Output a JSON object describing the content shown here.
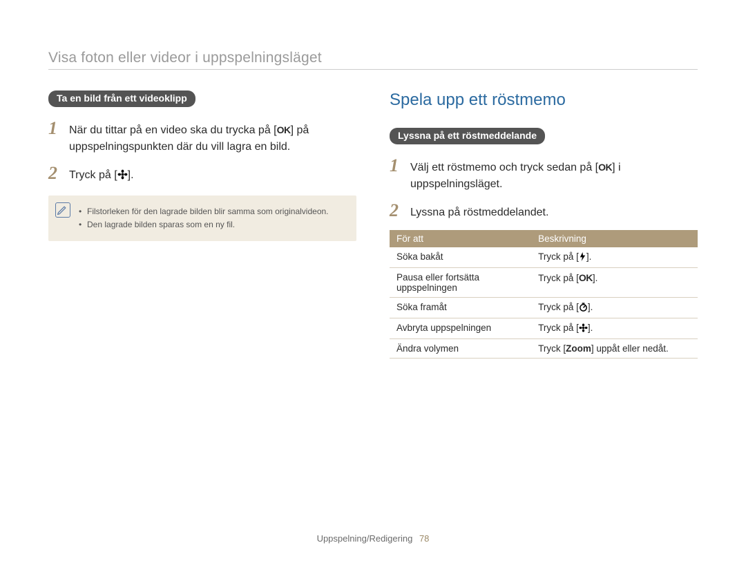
{
  "page_title": "Visa foton eller videor i uppspelningsläget",
  "left": {
    "pill": "Ta en bild från ett videoklipp",
    "step1_a": "När du tittar på en video ska du trycka på [",
    "step1_b": "] på uppspelningspunkten där du vill lagra en bild.",
    "step2_a": "Tryck på [",
    "step2_b": "].",
    "note_items": [
      "Filstorleken för den lagrade bilden blir samma som originalvideon.",
      "Den lagrade bilden sparas som en ny fil."
    ]
  },
  "right": {
    "heading": "Spela upp ett röstmemo",
    "pill": "Lyssna på ett röstmeddelande",
    "step1_a": "Välj ett röstmemo och tryck sedan på [",
    "step1_b": "] i uppspelningsläget.",
    "step2": "Lyssna på röstmeddelandet.",
    "table": {
      "headers": [
        "För att",
        "Beskrivning"
      ],
      "rows": [
        {
          "action": "Söka bakåt",
          "desc_a": "Tryck på [",
          "icon": "flash",
          "desc_b": "]."
        },
        {
          "action": "Pausa eller fortsätta uppspelningen",
          "desc_a": "Tryck på [",
          "icon": "ok",
          "desc_b": "]."
        },
        {
          "action": "Söka framåt",
          "desc_a": "Tryck på [",
          "icon": "timer",
          "desc_b": "]."
        },
        {
          "action": "Avbryta uppspelningen",
          "desc_a": "Tryck på [",
          "icon": "flower",
          "desc_b": "]."
        },
        {
          "action": "Ändra volymen",
          "desc_a": "Tryck [",
          "strong": "Zoom",
          "desc_b": "] uppåt eller nedåt."
        }
      ]
    }
  },
  "footer": {
    "section": "Uppspelning/Redigering",
    "page": "78"
  },
  "glyphs": {
    "ok": "OK"
  }
}
